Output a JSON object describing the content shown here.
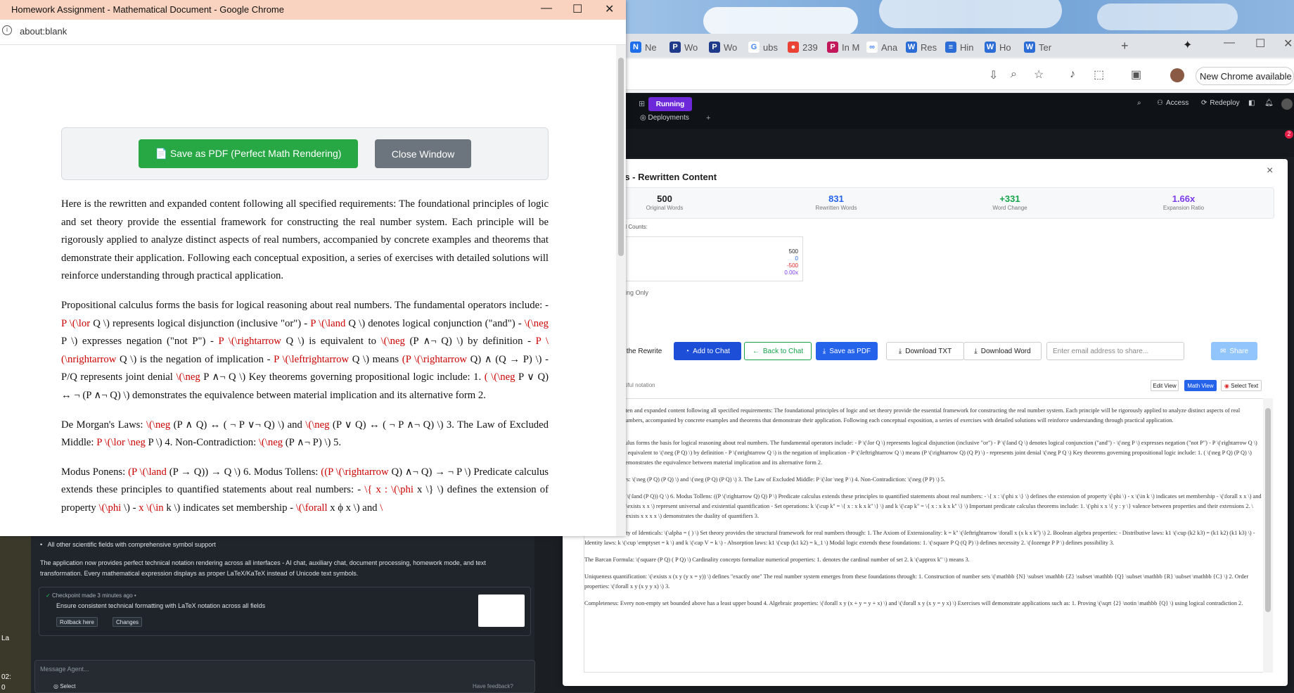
{
  "popup": {
    "title": "Homework Assignment - Mathematical Document - Google Chrome",
    "address": "about:blank",
    "save_button": "📄 Save as PDF (Perfect Math Rendering)",
    "close_button": "Close Window",
    "paragraphs": [
      [
        {
          "t": "Here is the rewritten and expanded content following all specified requirements: The foundational principles of logic and set theory provide the essential framework for constructing the real number system. Each principle will be rigorously applied to analyze distinct aspects of real numbers, accompanied by concrete examples and theorems that demonstrate their application. Following each conceptual exposition, a series of exercises with detailed solutions will reinforce understanding through practical application."
        }
      ],
      [
        {
          "t": "Propositional calculus forms the basis for logical reasoning about real numbers. The fundamental operators include: - "
        },
        {
          "t": "P \\(\\lor",
          "r": 1
        },
        {
          "t": " Q \\) represents logical disjunction (inclusive \"or\") - "
        },
        {
          "t": "P \\(\\land",
          "r": 1
        },
        {
          "t": " Q \\) denotes logical conjunction (\"and\") - "
        },
        {
          "t": "\\(\\neg",
          "r": 1
        },
        {
          "t": " P \\) expresses negation (\"not P\") - "
        },
        {
          "t": "P \\(\\rightarrow",
          "r": 1
        },
        {
          "t": " Q \\) is equivalent to "
        },
        {
          "t": "\\(\\neg",
          "r": 1
        },
        {
          "t": " (P ∧¬ Q) \\) by definition - "
        },
        {
          "t": "P \\(\\nrightarrow",
          "r": 1
        },
        {
          "t": " Q \\) is the negation of implication - "
        },
        {
          "t": "P \\(\\leftrightarrow",
          "r": 1
        },
        {
          "t": " Q \\) means "
        },
        {
          "t": "(P \\(\\rightarrow",
          "r": 1
        },
        {
          "t": " Q) ∧ (Q → P) \\) - P/Q represents joint denial "
        },
        {
          "t": "\\(\\neg",
          "r": 1
        },
        {
          "t": " P ∧¬ Q \\) Key theorems governing propositional logic include: 1. "
        },
        {
          "t": "( \\(\\neg",
          "r": 1
        },
        {
          "t": " P ∨ Q) ↔ ¬ (P ∧¬ Q) \\) demonstrates the equivalence between material implication and its alternative form 2."
        }
      ],
      [
        {
          "t": "De Morgan's Laws: "
        },
        {
          "t": "\\(\\neg",
          "r": 1
        },
        {
          "t": " (P ∧ Q) ↔ ( ¬ P ∨¬ Q) \\) and "
        },
        {
          "t": "\\(\\neg",
          "r": 1
        },
        {
          "t": " (P ∨ Q) ↔ ( ¬ P ∧¬ Q) \\) 3. The Law of Excluded Middle: "
        },
        {
          "t": "P \\(\\lor \\neg",
          "r": 1
        },
        {
          "t": " P \\) 4. Non-Contradiction: "
        },
        {
          "t": "\\(\\neg",
          "r": 1
        },
        {
          "t": " (P ∧¬ P) \\) 5."
        }
      ],
      [
        {
          "t": "Modus Ponens: "
        },
        {
          "t": "(P \\(\\land",
          "r": 1
        },
        {
          "t": " (P → Q)) → Q \\) 6. Modus Tollens: "
        },
        {
          "t": "((P \\(\\rightarrow",
          "r": 1
        },
        {
          "t": " Q) ∧¬ Q) → ¬ P \\) Predicate calculus extends these principles to quantified statements about real numbers: - "
        },
        {
          "t": "\\{ x : \\(\\phi",
          "r": 1
        },
        {
          "t": " x \\} \\) defines the extension of property "
        },
        {
          "t": "\\(\\phi",
          "r": 1
        },
        {
          "t": " \\) - "
        },
        {
          "t": "x \\(\\in",
          "r": 1
        },
        {
          "t": " k \\) indicates set membership - "
        },
        {
          "t": "\\(\\forall",
          "r": 1
        },
        {
          "t": " x ϕ x \\) and "
        },
        {
          "t": "\\",
          "r": 1
        }
      ]
    ]
  },
  "browser_tabs": [
    {
      "label": "Ne",
      "color": "#1f6feb",
      "glyph": "N"
    },
    {
      "label": "Wo",
      "color": "#1e3a8a",
      "glyph": "P"
    },
    {
      "label": "Wo",
      "color": "#1e3a8a",
      "glyph": "P"
    },
    {
      "label": "ubs",
      "color": "#ffffff",
      "glyph": "G"
    },
    {
      "label": "239",
      "color": "#ea4335",
      "glyph": "●"
    },
    {
      "label": "In M",
      "color": "#c2185b",
      "glyph": "P"
    },
    {
      "label": "Ana",
      "color": "#ffffff",
      "glyph": "∞"
    },
    {
      "label": "Res",
      "color": "#2b6cd6",
      "glyph": "W"
    },
    {
      "label": "Hin",
      "color": "#2b6cd6",
      "glyph": "≡"
    },
    {
      "label": "Ho",
      "color": "#2b6cd6",
      "glyph": "W"
    },
    {
      "label": "Ter",
      "color": "#2b6cd6",
      "glyph": "W"
    }
  ],
  "browser": {
    "new_chrome": "New Chrome available"
  },
  "appbar": {
    "running": "Running",
    "access": "Access",
    "redeploy": "Redeploy",
    "deployments": "Deployments",
    "badge": "2"
  },
  "modal": {
    "title": "ts - Rewritten Content",
    "stats": [
      {
        "value": "500",
        "label": "Original Words",
        "color": "#222"
      },
      {
        "value": "831",
        "label": "Rewritten Words",
        "color": "#2563eb"
      },
      {
        "value": "+331",
        "label": "Word Change",
        "color": "#16a34a"
      },
      {
        "value": "1.66x",
        "label": "Expansion Ratio",
        "color": "#7c3aed"
      }
    ],
    "word_counts_label": "rd Counts:",
    "word_counts": [
      "500",
      "0",
      "-500",
      "0.00x"
    ],
    "formatting": "tting Only",
    "buttons": {
      "rewrite": "the Rewrite",
      "add_chat": "Add to Chat",
      "back_chat": "Back to Chat",
      "save_pdf": "Save as PDF",
      "download_txt": "Download TXT",
      "download_word": "Download Word",
      "share_placeholder": "Enter email address to share...",
      "share": "Share"
    },
    "view_note": "utiful notation",
    "views": {
      "edit": "Edit View",
      "math": "Math View",
      "select": "Select Text"
    },
    "paragraphs": [
      "itten and expanded content following all specified requirements: The foundational principles of logic and set theory provide the essential framework for constructing the real number system. Each principle will be rigorously applied to analyze distinct aspects of real numbers, accompanied by concrete examples and theorems that demonstrate their application. Following each conceptual exposition, a series of exercises with detailed solutions will reinforce understanding through practical application.",
      "culus forms the basis for logical reasoning about real numbers. The fundamental operators include: - P \\(\\lor Q \\) represents logical disjunction (inclusive \"or\") - P \\(\\land Q \\) denotes logical conjunction (\"and\") - \\(\\neg P \\) expresses negation (\"not P\") - P \\(\\rightarrow Q \\) is equivalent to \\(\\neg (P Q) \\) by definition - P \\(\\nrightarrow Q \\) is the negation of implication - P \\(\\leftrightarrow Q \\) means (P \\(\\rightarrow Q) (Q P) \\) - represents joint denial \\(\\neg P Q \\) Key theorems governing propositional logic include: 1. ( \\(\\neg P Q) (P Q) \\) demonstrates the equivalence between material implication and its alternative form 2.",
      "ws: \\(\\neg (P Q) (P Q) \\) and \\(\\neg (P Q) (P Q) \\) 3. The Law of Excluded Middle: P \\(\\lor \\neg P \\) 4. Non-Contradiction: \\(\\neg (P P) \\) 5.",
      "P \\(\\land (P Q)) Q \\) 6. Modus Tollens: ((P \\(\\rightarrow Q) Q) P \\) Predicate calculus extends these principles to quantified statements about real numbers: - \\{ x : \\(\\phi x \\} \\) defines the extension of property \\(\\phi \\) - x \\(\\in k \\) indicates set membership - \\(\\forall x x \\) and \\(\\exists x x \\) represent universal and existential quantification - Set operations: k \\(\\cup k'' = \\{ x : x k x k'' \\} \\) and k \\(\\cap k'' = \\{ x : x k x k'' \\} \\) Important predicate calculus theorems include: 1. \\(\\phi x x \\{ y : y \\} valence between properties and their extensions 2. \\(\\exists x x x x \\) demonstrates the duality of quantifiers 3.",
      "The Indiscernibility of Identicals: \\(\\alpha = ( ) \\) Set theory provides the structural framework for real numbers through: 1. The Axiom of Extensionality: k = k'' \\(\\leftrightarrow \\forall x (x k x k'') \\) 2. Boolean algebra properties: - Distributive laws: k1 \\(\\cup (k2 k3) = (k1 k2) (k1 k3) \\) - Identity laws: k \\(\\cup \\emptyset = k \\) and k \\(\\cap V = k \\) - Absorption laws: k1 \\(\\cup (k1 k2) = k_1 \\) Modal logic extends these foundations: 1. \\(\\square P Q (Q P) \\) defines necessity 2. \\(\\lozenge P P \\) defines possibility 3.",
      "The Barcan Formula: \\(\\square (P Q) ( P Q) \\) Cardinality concepts formalize numerical properties: 1. denotes the cardinal number of set 2. k \\(\\approx k'' \\) means 3.",
      "Uniqueness quantification: \\(\\exists x (x y (y x = y)) \\) defines \"exactly one\" The real number system emerges from these foundations through: 1. Construction of number sets \\(\\mathbb {N} \\subset \\mathbb {Z} \\subset \\mathbb {Q} \\subset \\mathbb {R} \\subset \\mathbb {C} \\) 2. Order properties: \\(\\forall x y (x y y x) \\) 3.",
      "Completeness: Every non-empty set bounded above has a least upper bound 4. Algebraic properties: \\(\\forall x y (x + y = y + x) \\) and \\(\\forall x y (x y = y x) \\) Exercises will demonstrate applications such as: 1. Proving \\(\\sqrt {2} \\notin \\mathbb {Q} \\) using logical contradiction 2."
    ]
  },
  "agent_panel": {
    "bullet": "All other scientific fields with comprehensive symbol support",
    "summary": "The application now provides perfect technical notation rendering across all interfaces - AI chat, auxiliary chat, document processing, homework mode, and text transformation. Every mathematical expression displays as proper LaTeX/KaTeX instead of Unicode text symbols.",
    "checkpoint": "Checkpoint made 3 minutes ago •",
    "checkpoint_title": "Ensure consistent technical formatting with LaTeX notation across all fields",
    "rollback": "Rollback here",
    "changes": "Changes",
    "message_placeholder": "Message Agent...",
    "select": "Select",
    "feedback": "Have feedback?"
  },
  "left_edge": {
    "a": "La",
    "b": "02:",
    "c": "0"
  }
}
